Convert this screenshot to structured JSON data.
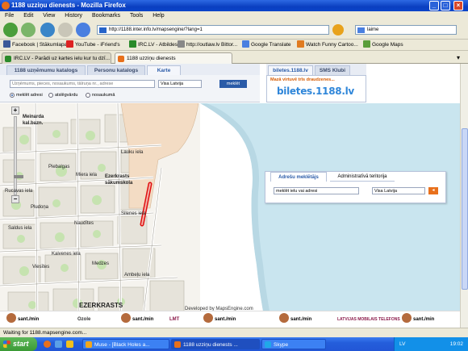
{
  "window": {
    "title": "1188 uzziņu dienests - Mozilla Firefox"
  },
  "menu": [
    "File",
    "Edit",
    "View",
    "History",
    "Bookmarks",
    "Tools",
    "Help"
  ],
  "navbar": {
    "url": "http://1188.inter.info.lv/mapsengine/?lang=1",
    "search_value": "laime"
  },
  "bookmarks": [
    {
      "label": "Facebook | Stākumlapa",
      "color": "#3b5998"
    },
    {
      "label": "YouTube - iFriend's",
      "color": "#d22"
    },
    {
      "label": "IRC.LV - Atbildes",
      "color": "#2a8a2a"
    },
    {
      "label": "http://outlaw.lv Bittor...",
      "color": "#888"
    },
    {
      "label": "Google Translate",
      "color": "#4a7fe0"
    },
    {
      "label": "Watch Funny Cartoo...",
      "color": "#e07b20"
    },
    {
      "label": "Google Maps",
      "color": "#5a9e3a"
    }
  ],
  "tabs": [
    {
      "label": "IRC.LV - Parādi uz kartes ielu kur tu dzī...",
      "color": "#2a8a2a"
    },
    {
      "label": "1188 uzziņu dienests",
      "color": "#e8701c"
    }
  ],
  "page": {
    "tabs": [
      "1188 uzņēmumu katalogs",
      "Personu katalogs",
      "Karte"
    ],
    "search_placeholder": "Uzņēmums, pieces, nosaukums, tālruņa nr., adrese",
    "region_select": "Visa Latvija",
    "find_button": "meklēt",
    "radios": [
      "meklēt adresi",
      "atslēgvārdu",
      "nosaukumā"
    ],
    "right_tabs": [
      "biletes.1188.lv",
      "SMS Klubi"
    ],
    "banner_tagline": "Mazā virtuvē trīs draudzenes...",
    "banner_logo": "biletes.1188.lv"
  },
  "address_panel": {
    "tabs": [
      "Adrešu meklētājs",
      "Administratīvā teritorija"
    ],
    "input_value": "meklēt ielu vai adresi",
    "select_value": "Visa Latvija"
  },
  "map": {
    "labels": [
      "Meinarda",
      "kal.bazn.",
      "Lauku iela",
      "Ezerkrasts",
      "sākumskola",
      "Piebalgas",
      "Miera iela",
      "Pludoņa",
      "Rucavas iela",
      "Saldus iela",
      "Kaivenes iela",
      "Naudītes",
      "Ambeļu iela",
      "EZERKRASTS",
      "Silenes iela",
      "Viesītes",
      "Medzes"
    ],
    "credit": "Developed by MapsEngine.com",
    "ads": [
      "sant./min",
      "sant./min",
      "sant./min",
      "sant./min",
      "sant./min"
    ],
    "ad_icon_labels": [
      "Ozole",
      "LMT",
      "LATVIJAS MOBILAIS TELEFONS"
    ]
  },
  "status": "Waiting for 1188.mapsengine.com...",
  "taskbar": {
    "start": "start",
    "tasks": [
      "Muse - [Black Holes a...",
      "1188 uzziņu dienests ...",
      "Skype"
    ],
    "tray_lang": "LV",
    "clock": "19:02"
  }
}
